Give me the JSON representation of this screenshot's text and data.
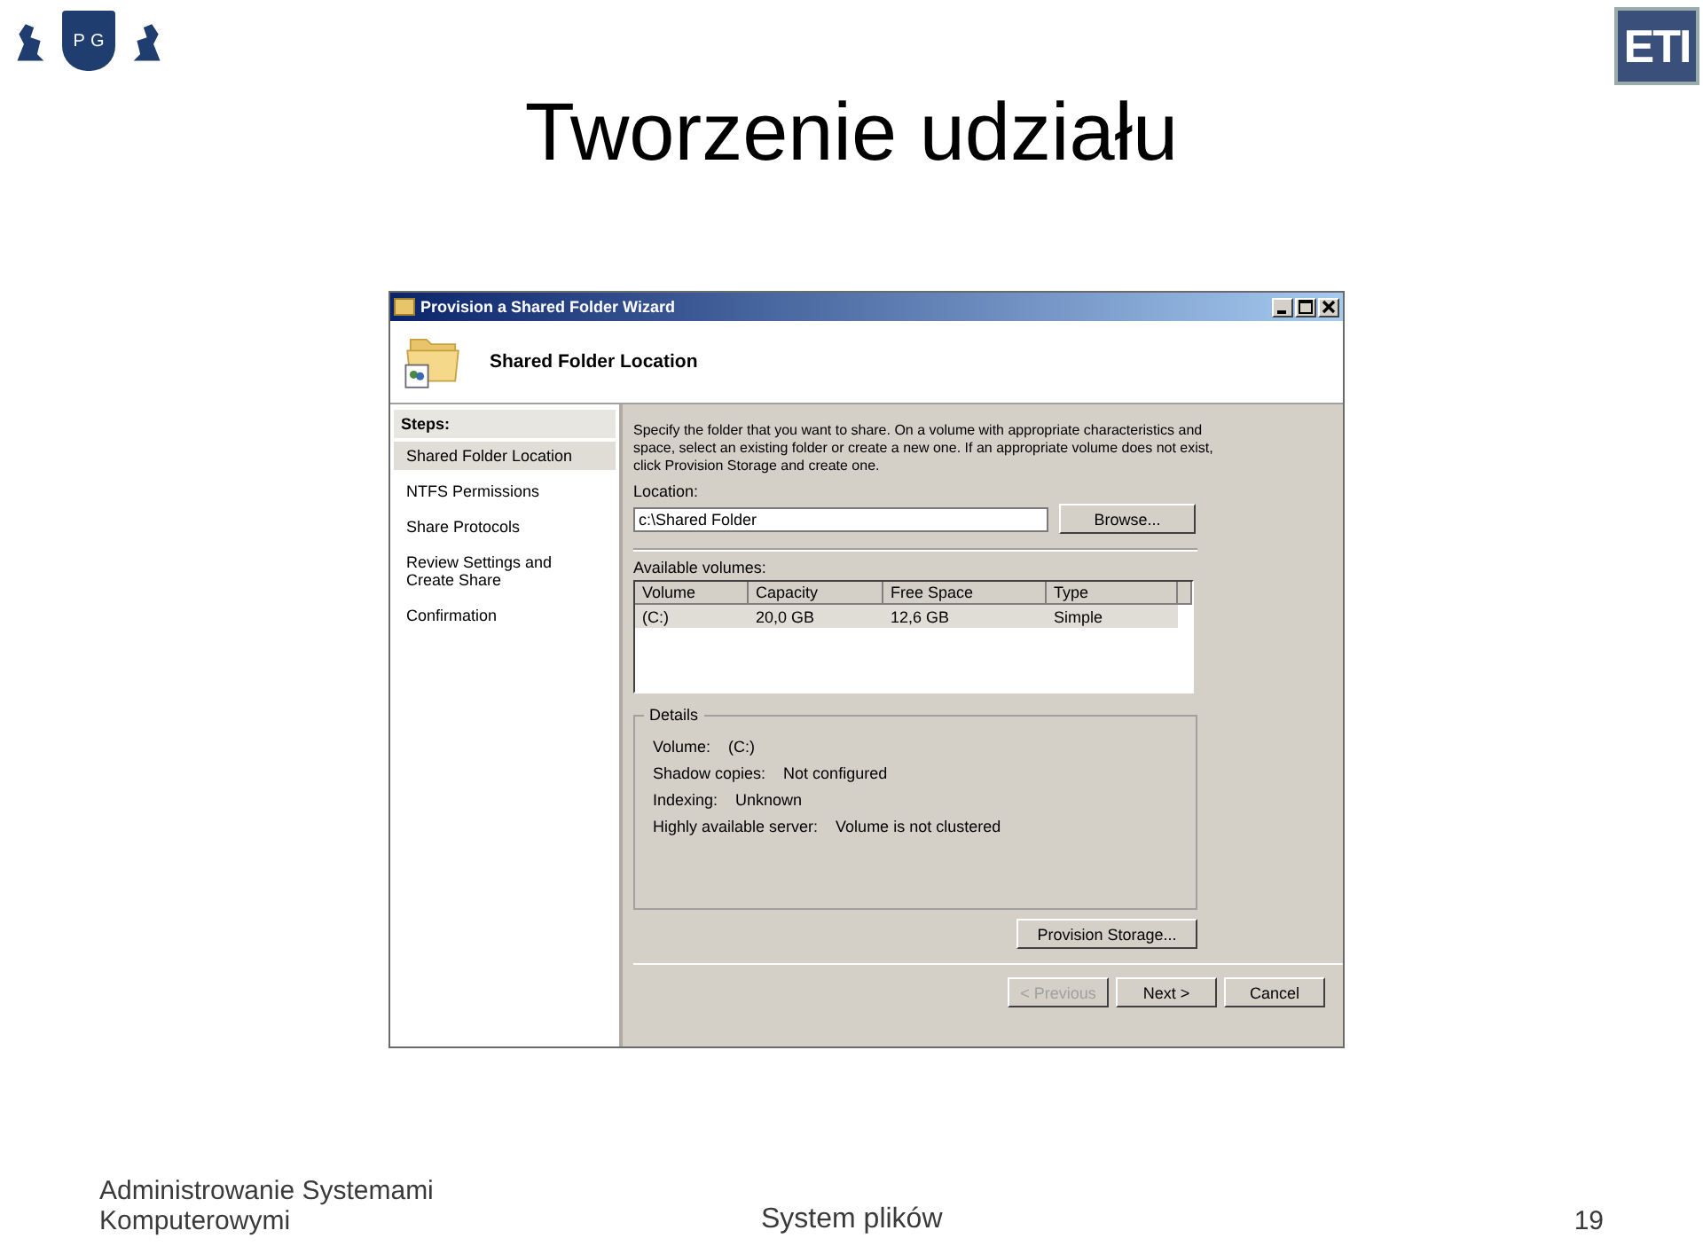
{
  "slide": {
    "title": "Tworzenie udziału",
    "logo_left": {
      "letters": [
        "P",
        "G"
      ]
    },
    "logo_right": {
      "text": "ETI"
    }
  },
  "window": {
    "title": "Provision a Shared Folder Wizard",
    "header": "Shared Folder Location",
    "steps_label": "Steps:",
    "steps": [
      {
        "label": "Shared Folder Location",
        "selected": true
      },
      {
        "label": "NTFS Permissions",
        "selected": false
      },
      {
        "label": "Share Protocols",
        "selected": false
      },
      {
        "label": "Review Settings and Create Share",
        "selected": false
      },
      {
        "label": "Confirmation",
        "selected": false
      }
    ],
    "description": "Specify the folder that you want to share. On a volume with appropriate characteristics and space, select an existing folder or create a new one. If an appropriate volume does not exist, click Provision Storage and create one.",
    "location": {
      "label": "Location:",
      "value": "c:\\Shared Folder",
      "button": "Browse..."
    },
    "volumes": {
      "label": "Available volumes:",
      "columns": [
        "Volume",
        "Capacity",
        "Free Space",
        "Type"
      ],
      "rows": [
        {
          "cells": [
            "(C:)",
            "20,0 GB",
            "12,6 GB",
            "Simple"
          ],
          "selected": true
        }
      ]
    },
    "details": {
      "title": "Details",
      "items": [
        {
          "label": "Volume:",
          "value": "(C:)"
        },
        {
          "label": "Shadow copies:",
          "value": "Not configured"
        },
        {
          "label": "Indexing:",
          "value": "Unknown"
        },
        {
          "label": "Highly available server:",
          "value": "Volume is not clustered"
        }
      ]
    },
    "provision_button": "Provision Storage...",
    "buttons": [
      {
        "label": "< Previous",
        "disabled": true
      },
      {
        "label": "Next >",
        "disabled": false
      },
      {
        "label": "Cancel",
        "disabled": false
      }
    ]
  },
  "footer": {
    "course": "Administrowanie Systemami Komputerowymi",
    "topic": "System plików",
    "page": "19"
  }
}
